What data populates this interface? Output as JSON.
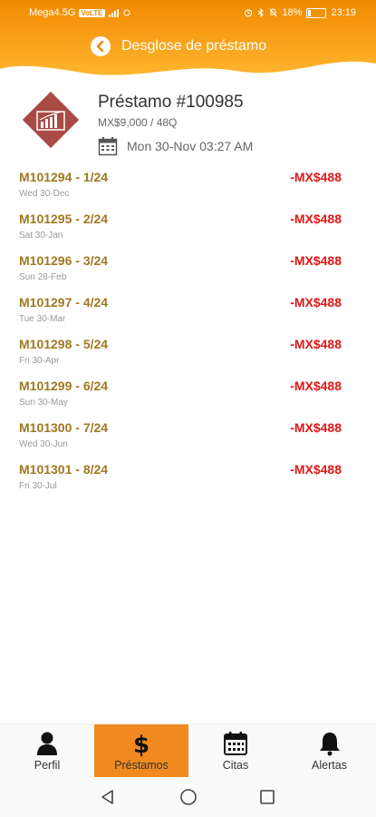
{
  "status_bar": {
    "carrier": "Mega4.5G",
    "network_badge": "VoLTE",
    "battery": "18%",
    "time": "23:19"
  },
  "header": {
    "title": "Desglose de préstamo",
    "colors": {
      "accent": "#f08a00",
      "accent_light": "#ffb733"
    }
  },
  "loan": {
    "title": "Préstamo #100985",
    "subtitle": "MX$9,000 / 48Q",
    "date": "Mon 30-Nov 03:27 AM",
    "icon": "chart-growth-icon"
  },
  "installments": [
    {
      "code": "M101294 - 1/24",
      "date": "Wed 30-Dec",
      "amount": "-MX$488"
    },
    {
      "code": "M101295 - 2/24",
      "date": "Sat 30-Jan",
      "amount": "-MX$488"
    },
    {
      "code": "M101296 - 3/24",
      "date": "Sun 28-Feb",
      "amount": "-MX$488"
    },
    {
      "code": "M101297 - 4/24",
      "date": "Tue 30-Mar",
      "amount": "-MX$488"
    },
    {
      "code": "M101298 - 5/24",
      "date": "Fri 30-Apr",
      "amount": "-MX$488"
    },
    {
      "code": "M101299 - 6/24",
      "date": "Sun 30-May",
      "amount": "-MX$488"
    },
    {
      "code": "M101300 - 7/24",
      "date": "Wed 30-Jun",
      "amount": "-MX$488"
    },
    {
      "code": "M101301 - 8/24",
      "date": "Fri 30-Jul",
      "amount": "-MX$488"
    }
  ],
  "bottom_nav": {
    "items": [
      {
        "label": "Perfil",
        "icon": "person-icon",
        "active": false
      },
      {
        "label": "Préstamos",
        "icon": "dollar-icon",
        "active": true
      },
      {
        "label": "Citas",
        "icon": "calendar-icon",
        "active": false
      },
      {
        "label": "Alertas",
        "icon": "bell-icon",
        "active": false
      }
    ]
  }
}
